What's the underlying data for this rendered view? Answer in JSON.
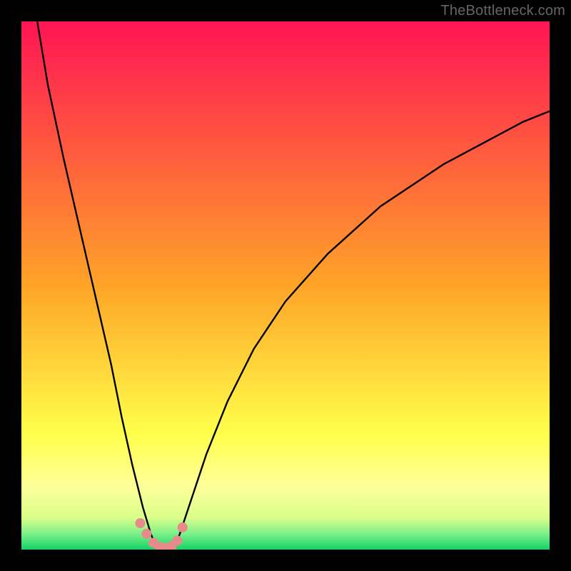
{
  "watermark": "TheBottleneck.com",
  "chart_data": {
    "type": "line",
    "title": "",
    "xlabel": "",
    "ylabel": "",
    "xlim": [
      0,
      100
    ],
    "ylim": [
      0,
      100
    ],
    "background_gradient": {
      "direction": "vertical",
      "stops": [
        {
          "pos": 0,
          "color": "#ff1454"
        },
        {
          "pos": 50,
          "color": "#ffa428"
        },
        {
          "pos": 78,
          "color": "#ffff4a"
        },
        {
          "pos": 88,
          "color": "#ffff9a"
        },
        {
          "pos": 94,
          "color": "#d9ff8a"
        },
        {
          "pos": 97,
          "color": "#7cf08a"
        },
        {
          "pos": 100,
          "color": "#17d267"
        }
      ]
    },
    "series": [
      {
        "name": "left-curve",
        "x": [
          3,
          5,
          8,
          11,
          14,
          17,
          19,
          21,
          23,
          24.5,
          25.5
        ],
        "y": [
          100,
          88,
          74,
          61,
          48,
          35,
          25,
          16,
          8,
          3,
          0.5
        ]
      },
      {
        "name": "right-curve",
        "x": [
          29,
          30,
          32,
          35,
          39,
          44,
          50,
          58,
          68,
          80,
          95,
          100
        ],
        "y": [
          0.5,
          3,
          9,
          18,
          28,
          38,
          47,
          56,
          65,
          73,
          81,
          83
        ]
      },
      {
        "name": "trough",
        "x": [
          25.5,
          26.5,
          27.5,
          28.5,
          29
        ],
        "y": [
          0.5,
          0,
          0,
          0.2,
          0.5
        ]
      }
    ],
    "trough_markers": {
      "color": "#e98a8a",
      "points": [
        {
          "x": 22.5,
          "y": 5
        },
        {
          "x": 23.7,
          "y": 3
        },
        {
          "x": 25.0,
          "y": 1.3
        },
        {
          "x": 26.2,
          "y": 0.5
        },
        {
          "x": 27.3,
          "y": 0.3
        },
        {
          "x": 28.4,
          "y": 0.6
        },
        {
          "x": 29.5,
          "y": 1.7
        },
        {
          "x": 30.5,
          "y": 4.2
        }
      ],
      "radius": 7
    }
  }
}
